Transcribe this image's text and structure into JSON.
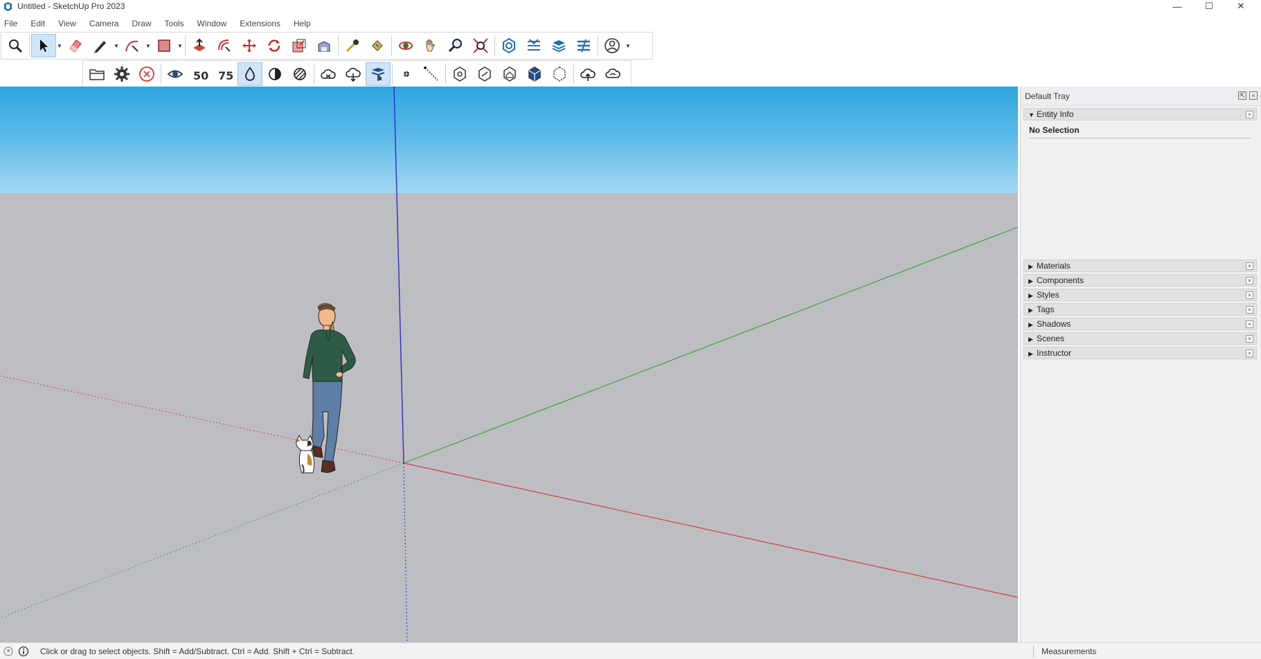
{
  "window": {
    "title": "Untitled - SketchUp Pro 2023",
    "controls": {
      "minimize": "—",
      "maximize": "☐",
      "close": "✕"
    }
  },
  "menu": [
    "File",
    "Edit",
    "View",
    "Camera",
    "Draw",
    "Tools",
    "Window",
    "Extensions",
    "Help"
  ],
  "toolbar_top": [
    "search-icon",
    "select-arrow-icon",
    "eraser-icon",
    "pencil-line-icon",
    "arc-icon",
    "rectangle-icon",
    "push-pull-icon",
    "offset-icon",
    "move-icon",
    "rotate-icon",
    "scale-icon",
    "follow-me-icon",
    "tape-measure-icon",
    "paint-bucket-icon",
    "orbit-icon",
    "pan-icon",
    "zoom-icon",
    "zoom-extents-icon",
    "trimble-connect-icon",
    "layout-icon",
    "3d-warehouse-icon",
    "extension-warehouse-icon",
    "account-icon"
  ],
  "toolbar_bottom": [
    "open-folder-icon",
    "settings-gear-icon",
    "cancel-icon",
    "xray-icon",
    "speed-50-icon",
    "speed-75-icon",
    "water-drop-icon",
    "contrast-icon",
    "stripe-icon",
    "cloud-sync-icon",
    "cloud-download-icon",
    "stack-hand-icon",
    "point-icon",
    "dashed-line-icon",
    "iso-view-icon",
    "top-view-icon",
    "front-view-icon",
    "right-view-icon",
    "back-view-icon",
    "cloud-upload-icon",
    "cloud-share-icon"
  ],
  "tray": {
    "title": "Default Tray",
    "pin_label": "⇱",
    "close_label": "×",
    "panels": [
      {
        "name": "Entity Info",
        "expanded": true
      },
      {
        "name": "Materials",
        "expanded": false
      },
      {
        "name": "Components",
        "expanded": false
      },
      {
        "name": "Styles",
        "expanded": false
      },
      {
        "name": "Tags",
        "expanded": false
      },
      {
        "name": "Shadows",
        "expanded": false
      },
      {
        "name": "Scenes",
        "expanded": false
      },
      {
        "name": "Instructor",
        "expanded": false
      }
    ],
    "entity_info_status": "No Selection",
    "panel_close_label": "×",
    "expanded_triangle": "▼",
    "collapsed_triangle": "▶"
  },
  "status": {
    "message": "Click or drag to select objects. Shift = Add/Subtract. Ctrl = Add. Shift + Ctrl = Subtract.",
    "measurements_label": "Measurements"
  },
  "colors": {
    "sky_top": "#2ea6df",
    "ground": "#bdbec2",
    "axis_red": "#d43c3c",
    "axis_green": "#3fa33f",
    "axis_blue": "#2b2bd0",
    "active_tool": "#cfe4f7"
  }
}
